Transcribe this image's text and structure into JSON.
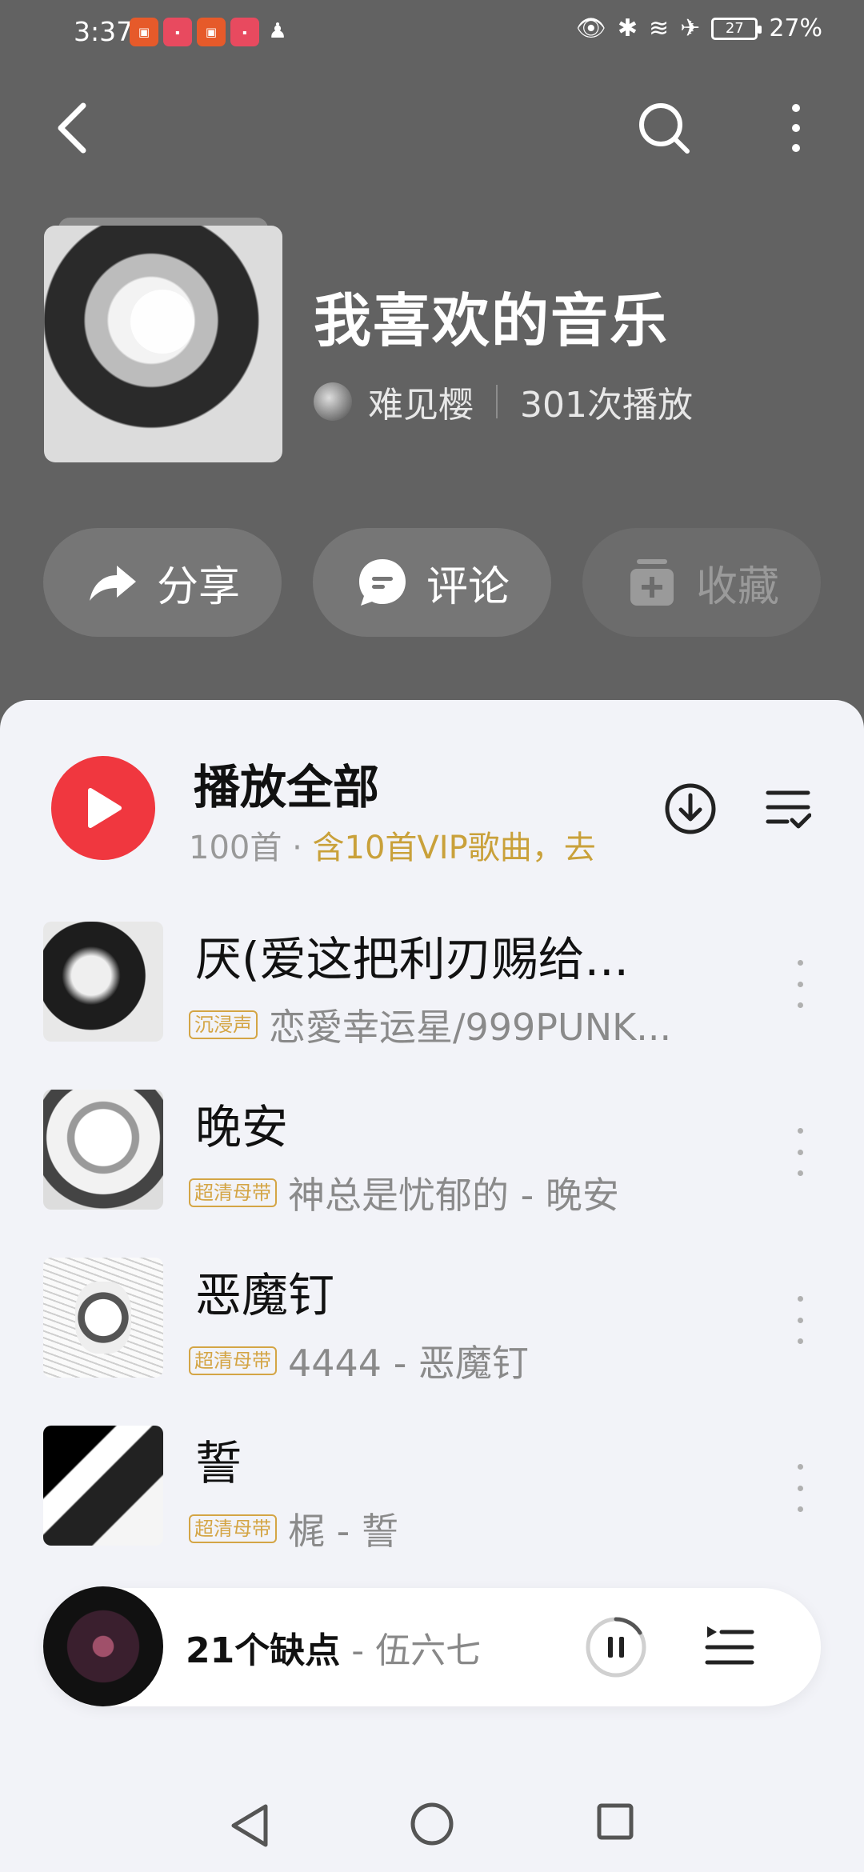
{
  "status_bar": {
    "time": "3:37",
    "battery_text": "27%",
    "battery": "27"
  },
  "nav": {
    "back_icon": "chevron-left-icon",
    "search_icon": "search-icon",
    "more_icon": "more-vertical-icon"
  },
  "playlist": {
    "title": "我喜欢的音乐",
    "owner": "难见樱",
    "play_count": "301次播放"
  },
  "actions": {
    "share_label": "分享",
    "comment_label": "评论",
    "favorite_label": "收藏"
  },
  "play_all": {
    "title": "播放全部",
    "count": "100首",
    "separator": "·",
    "vip_note": "含10首VIP歌曲，去"
  },
  "songs": [
    {
      "name": "厌(爱这把利刃赐给...",
      "tag": "沉浸声",
      "artist": "恋愛幸运星/999PUNK..."
    },
    {
      "name": "晚安",
      "tag": "超清母带",
      "artist": "神总是忧郁的 - 晚安"
    },
    {
      "name": "恶魔钉",
      "tag": "超清母带",
      "artist": "4444 - 恶魔钉"
    },
    {
      "name": "誓",
      "tag": "超清母带",
      "artist": "梶 - 誓"
    }
  ],
  "now_playing": {
    "title": "21个缺点",
    "artist": " - 伍六七"
  },
  "colors": {
    "header_bg": "#626262",
    "panel_bg": "#f2f3f8",
    "accent_red": "#f0373f",
    "vip_gold": "#c9a13a"
  }
}
